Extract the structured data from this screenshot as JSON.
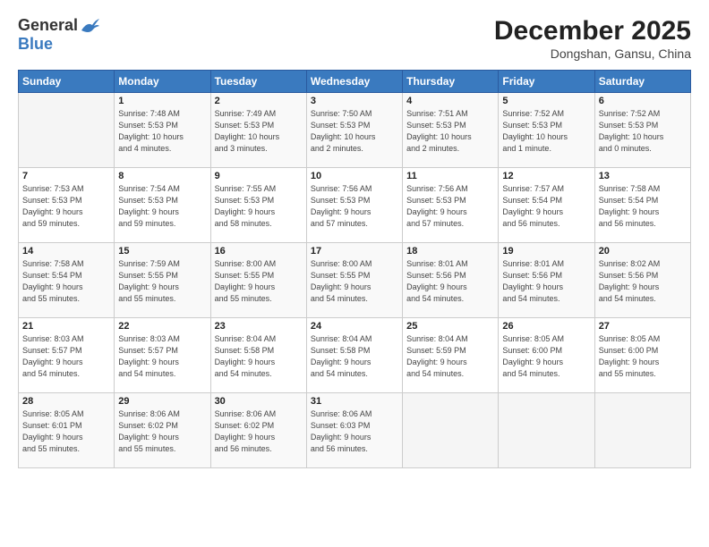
{
  "logo": {
    "general": "General",
    "blue": "Blue"
  },
  "title": "December 2025",
  "location": "Dongshan, Gansu, China",
  "days_header": [
    "Sunday",
    "Monday",
    "Tuesday",
    "Wednesday",
    "Thursday",
    "Friday",
    "Saturday"
  ],
  "weeks": [
    [
      {
        "day": "",
        "info": ""
      },
      {
        "day": "1",
        "info": "Sunrise: 7:48 AM\nSunset: 5:53 PM\nDaylight: 10 hours\nand 4 minutes."
      },
      {
        "day": "2",
        "info": "Sunrise: 7:49 AM\nSunset: 5:53 PM\nDaylight: 10 hours\nand 3 minutes."
      },
      {
        "day": "3",
        "info": "Sunrise: 7:50 AM\nSunset: 5:53 PM\nDaylight: 10 hours\nand 2 minutes."
      },
      {
        "day": "4",
        "info": "Sunrise: 7:51 AM\nSunset: 5:53 PM\nDaylight: 10 hours\nand 2 minutes."
      },
      {
        "day": "5",
        "info": "Sunrise: 7:52 AM\nSunset: 5:53 PM\nDaylight: 10 hours\nand 1 minute."
      },
      {
        "day": "6",
        "info": "Sunrise: 7:52 AM\nSunset: 5:53 PM\nDaylight: 10 hours\nand 0 minutes."
      }
    ],
    [
      {
        "day": "7",
        "info": "Sunrise: 7:53 AM\nSunset: 5:53 PM\nDaylight: 9 hours\nand 59 minutes."
      },
      {
        "day": "8",
        "info": "Sunrise: 7:54 AM\nSunset: 5:53 PM\nDaylight: 9 hours\nand 59 minutes."
      },
      {
        "day": "9",
        "info": "Sunrise: 7:55 AM\nSunset: 5:53 PM\nDaylight: 9 hours\nand 58 minutes."
      },
      {
        "day": "10",
        "info": "Sunrise: 7:56 AM\nSunset: 5:53 PM\nDaylight: 9 hours\nand 57 minutes."
      },
      {
        "day": "11",
        "info": "Sunrise: 7:56 AM\nSunset: 5:53 PM\nDaylight: 9 hours\nand 57 minutes."
      },
      {
        "day": "12",
        "info": "Sunrise: 7:57 AM\nSunset: 5:54 PM\nDaylight: 9 hours\nand 56 minutes."
      },
      {
        "day": "13",
        "info": "Sunrise: 7:58 AM\nSunset: 5:54 PM\nDaylight: 9 hours\nand 56 minutes."
      }
    ],
    [
      {
        "day": "14",
        "info": "Sunrise: 7:58 AM\nSunset: 5:54 PM\nDaylight: 9 hours\nand 55 minutes."
      },
      {
        "day": "15",
        "info": "Sunrise: 7:59 AM\nSunset: 5:55 PM\nDaylight: 9 hours\nand 55 minutes."
      },
      {
        "day": "16",
        "info": "Sunrise: 8:00 AM\nSunset: 5:55 PM\nDaylight: 9 hours\nand 55 minutes."
      },
      {
        "day": "17",
        "info": "Sunrise: 8:00 AM\nSunset: 5:55 PM\nDaylight: 9 hours\nand 54 minutes."
      },
      {
        "day": "18",
        "info": "Sunrise: 8:01 AM\nSunset: 5:56 PM\nDaylight: 9 hours\nand 54 minutes."
      },
      {
        "day": "19",
        "info": "Sunrise: 8:01 AM\nSunset: 5:56 PM\nDaylight: 9 hours\nand 54 minutes."
      },
      {
        "day": "20",
        "info": "Sunrise: 8:02 AM\nSunset: 5:56 PM\nDaylight: 9 hours\nand 54 minutes."
      }
    ],
    [
      {
        "day": "21",
        "info": "Sunrise: 8:03 AM\nSunset: 5:57 PM\nDaylight: 9 hours\nand 54 minutes."
      },
      {
        "day": "22",
        "info": "Sunrise: 8:03 AM\nSunset: 5:57 PM\nDaylight: 9 hours\nand 54 minutes."
      },
      {
        "day": "23",
        "info": "Sunrise: 8:04 AM\nSunset: 5:58 PM\nDaylight: 9 hours\nand 54 minutes."
      },
      {
        "day": "24",
        "info": "Sunrise: 8:04 AM\nSunset: 5:58 PM\nDaylight: 9 hours\nand 54 minutes."
      },
      {
        "day": "25",
        "info": "Sunrise: 8:04 AM\nSunset: 5:59 PM\nDaylight: 9 hours\nand 54 minutes."
      },
      {
        "day": "26",
        "info": "Sunrise: 8:05 AM\nSunset: 6:00 PM\nDaylight: 9 hours\nand 54 minutes."
      },
      {
        "day": "27",
        "info": "Sunrise: 8:05 AM\nSunset: 6:00 PM\nDaylight: 9 hours\nand 55 minutes."
      }
    ],
    [
      {
        "day": "28",
        "info": "Sunrise: 8:05 AM\nSunset: 6:01 PM\nDaylight: 9 hours\nand 55 minutes."
      },
      {
        "day": "29",
        "info": "Sunrise: 8:06 AM\nSunset: 6:02 PM\nDaylight: 9 hours\nand 55 minutes."
      },
      {
        "day": "30",
        "info": "Sunrise: 8:06 AM\nSunset: 6:02 PM\nDaylight: 9 hours\nand 56 minutes."
      },
      {
        "day": "31",
        "info": "Sunrise: 8:06 AM\nSunset: 6:03 PM\nDaylight: 9 hours\nand 56 minutes."
      },
      {
        "day": "",
        "info": ""
      },
      {
        "day": "",
        "info": ""
      },
      {
        "day": "",
        "info": ""
      }
    ]
  ]
}
